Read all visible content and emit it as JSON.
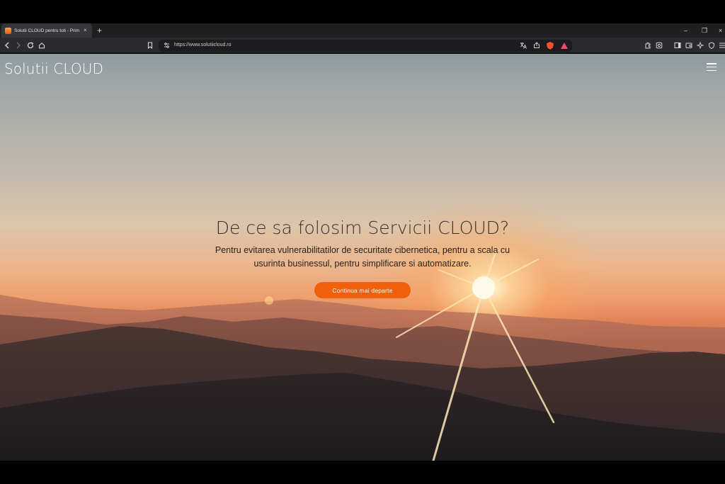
{
  "browser": {
    "tab_title": "Solutii CLOUD pentru toti - Prim",
    "tab_close": "×",
    "new_tab": "+",
    "url": "https://www.solutiicloud.ro",
    "window_controls": {
      "minimize": "–",
      "restore": "❐",
      "close": "×"
    },
    "icons": [
      "back-icon",
      "forward-icon",
      "reload-icon",
      "home-icon",
      "bookmark-icon",
      "site-info-icon",
      "translate-icon",
      "share-icon",
      "brave-shields-icon",
      "brave-rewards-icon",
      "extensions-icon",
      "screenshot-icon",
      "sidebar-icon",
      "wallet-icon",
      "leo-ai-icon",
      "vpn-icon",
      "menu-icon"
    ]
  },
  "site": {
    "brand": "Solutii CLOUD",
    "hero": {
      "title": "De ce sa folosim Servicii CLOUD?",
      "subtitle": "Pentru evitarea vulnerabilitatilor de securitate cibernetica, pentru a scala cu usurinta businessul, pentru simplificare si automatizare.",
      "cta_label": "Continua mai departe"
    }
  },
  "colors": {
    "accent": "#f05f0b",
    "title_text": "#3a302b",
    "chrome_bg": "#2b2b2e"
  }
}
